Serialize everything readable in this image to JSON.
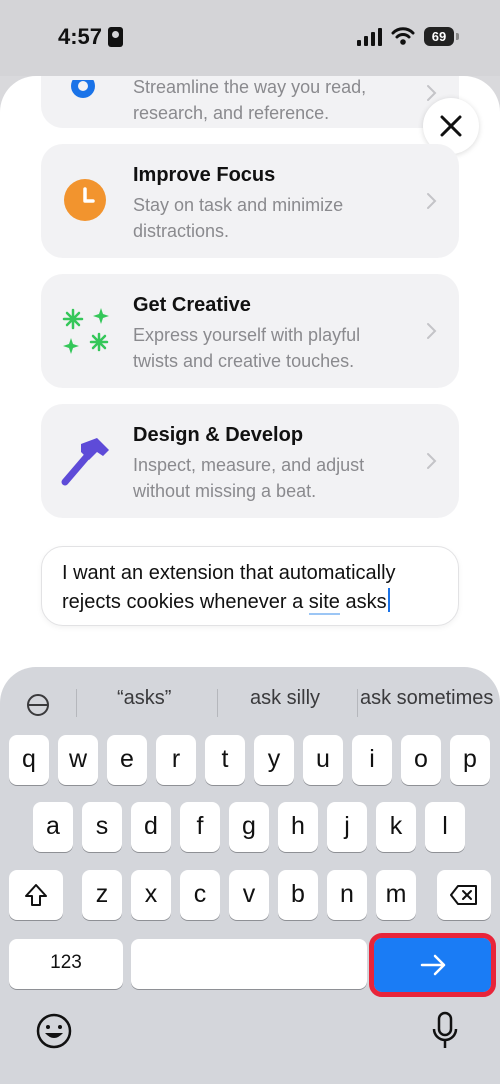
{
  "status": {
    "time": "4:57",
    "battery": "69"
  },
  "cards": [
    {
      "title": "",
      "description": "Streamline the way you read, research, and reference.",
      "icon": "gear-icon",
      "color": "#1a73e8"
    },
    {
      "title": "Improve Focus",
      "description": "Stay on task and minimize distractions.",
      "icon": "clock-icon",
      "color": "#f2942e"
    },
    {
      "title": "Get Creative",
      "description": "Express yourself with playful twists and creative touches.",
      "icon": "sparkles-icon",
      "color": "#34c759"
    },
    {
      "title": "Design & Develop",
      "description": "Inspect, measure, and adjust without missing a beat.",
      "icon": "hammer-icon",
      "color": "#5e4bd8"
    }
  ],
  "prompt": {
    "line1": "I want an extension that automatically",
    "line2_before": "rejects cookies whenever a ",
    "line2_word": "site",
    "line2_after": " asks"
  },
  "keyboard": {
    "suggestions": [
      "“asks”",
      "ask silly",
      "ask sometimes"
    ],
    "row1": [
      "q",
      "w",
      "e",
      "r",
      "t",
      "y",
      "u",
      "i",
      "o",
      "p"
    ],
    "row2": [
      "a",
      "s",
      "d",
      "f",
      "g",
      "h",
      "j",
      "k",
      "l"
    ],
    "row3": [
      "z",
      "x",
      "c",
      "v",
      "b",
      "n",
      "m"
    ],
    "numbers_label": "123",
    "accent_color": "#1a7cf5",
    "highlight_color": "#e8253a"
  }
}
